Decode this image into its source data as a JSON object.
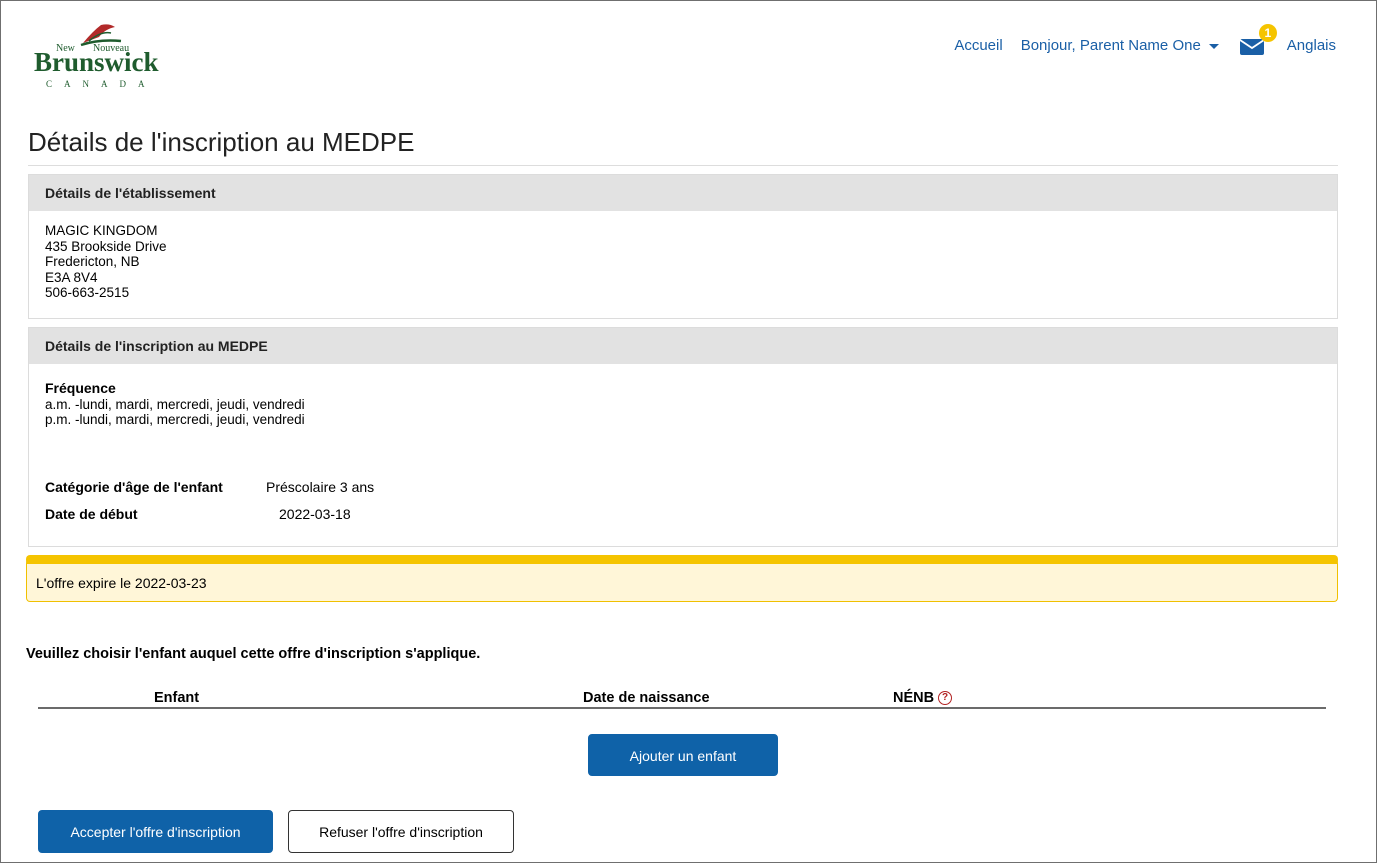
{
  "logo": {
    "new": "New",
    "nouveau": "Nouveau",
    "brunswick": "Brunswick",
    "canada": "CANADA"
  },
  "nav": {
    "home": "Accueil",
    "user": "Bonjour, Parent Name One",
    "notification_count": "1",
    "language": "Anglais"
  },
  "page_title": "Détails de l'inscription au MEDPE",
  "facility": {
    "heading": "Détails de l'établissement",
    "lines": [
      "MAGIC KINGDOM",
      "435 Brookside Drive",
      "Fredericton, NB",
      "E3A 8V4",
      "506-663-2515"
    ]
  },
  "registration": {
    "heading": "Détails de l'inscription au MEDPE",
    "frequency_label": "Fréquence",
    "frequency_lines": [
      "a.m. -lundi, mardi, mercredi, jeudi, vendredi",
      "p.m. -lundi, mardi, mercredi, jeudi, vendredi"
    ],
    "age_label": "Catégorie d'âge de l'enfant",
    "age_value": "Préscolaire 3 ans",
    "start_label": "Date de début",
    "start_value": "2022-03-18"
  },
  "warning": "L'offre expire le 2022-03-23",
  "instruction": "Veuillez choisir l'enfant auquel cette offre d'inscription s'applique.",
  "table": {
    "columns": [
      "Enfant",
      "Date de naissance",
      "NÉNB"
    ],
    "help_glyph": "?"
  },
  "buttons": {
    "add_child": "Ajouter un enfant",
    "accept": "Accepter l'offre d'inscription",
    "refuse": "Refuser l'offre d'inscription"
  },
  "colors": {
    "link": "#1a5fa6",
    "primary": "#0f62a8",
    "warning_border": "#f5c400",
    "warning_bg": "#fff6d8",
    "panel_head": "#e2e2e2"
  }
}
